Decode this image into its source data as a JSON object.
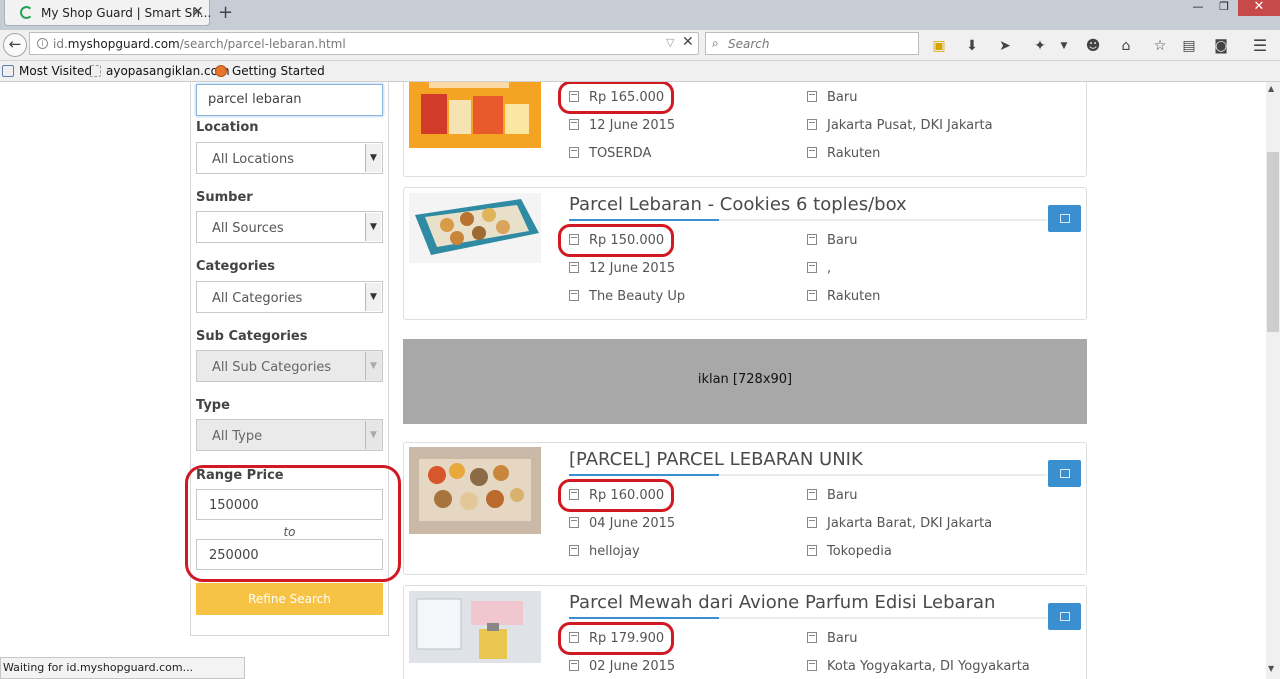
{
  "browser": {
    "tab_title": "My Shop Guard | Smart Sh...",
    "tab_close": "✕",
    "new_tab": "+",
    "win_min": "—",
    "win_max": "❐",
    "win_close": "✕",
    "url_prefix": "id.",
    "url_domain": "myshopguard.com",
    "url_path": "/search/parcel-lebaran.html",
    "search_placeholder": "Search",
    "bookmarks": [
      "Most Visited",
      "ayopasangiklan.com",
      "Getting Started"
    ],
    "status_text": "Waiting for id.myshopguard.com..."
  },
  "filters": {
    "keyword": "parcel lebaran",
    "location_label": "Location",
    "location_value": "All Locations",
    "source_label": "Sumber",
    "source_value": "All Sources",
    "categories_label": "Categories",
    "categories_value": "All Categories",
    "subcategories_label": "Sub Categories",
    "subcategories_value": "All Sub Categories",
    "type_label": "Type",
    "type_value": "All Type",
    "range_label": "Range Price",
    "price_min": "150000",
    "range_to": "to",
    "price_max": "250000",
    "refine_label": "Refine Search"
  },
  "ad": {
    "text": "iklan [728x90]"
  },
  "results": [
    {
      "title": "",
      "price": "Rp 165.000",
      "date": "12 June 2015",
      "seller": "TOSERDA",
      "condition": "Baru",
      "location": "Jakarta Pusat, DKI Jakarta",
      "marketplace": "Rakuten"
    },
    {
      "title": "Parcel Lebaran - Cookies 6 toples/box",
      "price": "Rp 150.000",
      "date": "12 June 2015",
      "seller": "The Beauty Up",
      "condition": "Baru",
      "location": ",",
      "marketplace": "Rakuten"
    },
    {
      "title": "[PARCEL] PARCEL LEBARAN UNIK",
      "price": "Rp 160.000",
      "date": "04 June 2015",
      "seller": "hellojay",
      "condition": "Baru",
      "location": "Jakarta Barat, DKI Jakarta",
      "marketplace": "Tokopedia"
    },
    {
      "title": "Parcel Mewah dari Avione Parfum Edisi Lebaran",
      "price": "Rp 179.900",
      "date": "02 June 2015",
      "seller": "",
      "condition": "Baru",
      "location": "Kota Yogyakarta, DI Yogyakarta",
      "marketplace": ""
    }
  ],
  "colors": {
    "accent_blue": "#3a8fd0",
    "refine_yellow": "#f6c344",
    "annotation_red": "#d01923"
  }
}
